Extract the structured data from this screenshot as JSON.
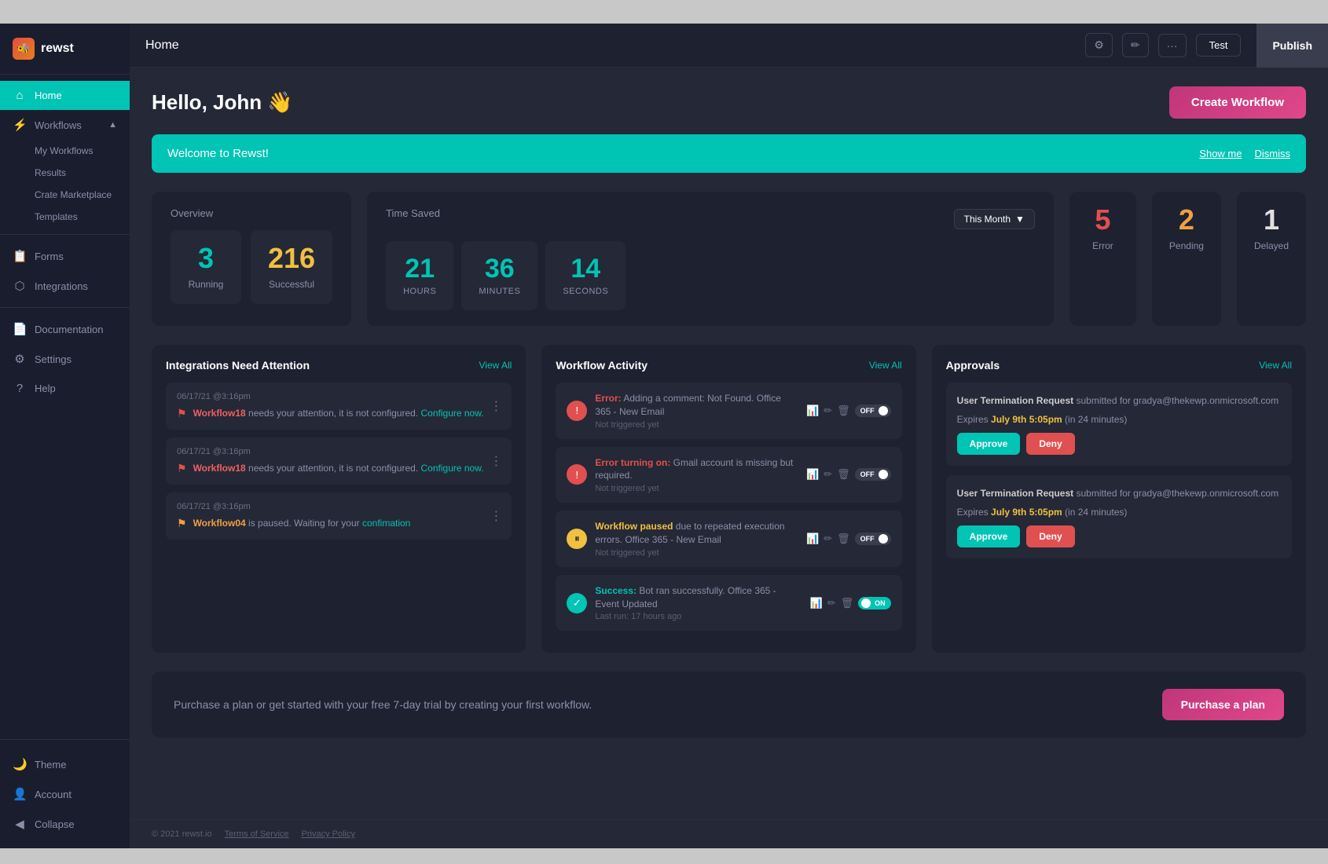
{
  "app": {
    "logo": "🐝",
    "logo_text": "rewst",
    "topbar_title": "Home",
    "publish_label": "Publish",
    "test_label": "Test"
  },
  "sidebar": {
    "nav_items": [
      {
        "id": "home",
        "label": "Home",
        "icon": "⌂",
        "active": true
      },
      {
        "id": "workflows",
        "label": "Workflows",
        "icon": "⚡",
        "has_chevron": true
      },
      {
        "id": "forms",
        "label": "Forms",
        "icon": "📋"
      },
      {
        "id": "integrations",
        "label": "Integrations",
        "icon": "🔗"
      },
      {
        "id": "documentation",
        "label": "Documentation",
        "icon": "📄"
      },
      {
        "id": "settings",
        "label": "Settings",
        "icon": "⚙"
      },
      {
        "id": "help",
        "label": "Help",
        "icon": "?"
      }
    ],
    "sub_items": [
      "My Workflows",
      "Results",
      "Crate Marketplace",
      "Templates"
    ],
    "bottom_items": [
      {
        "id": "theme",
        "label": "Theme",
        "icon": "🌙"
      },
      {
        "id": "account",
        "label": "Account",
        "icon": "👤"
      },
      {
        "id": "collapse",
        "label": "Collapse",
        "icon": "◀"
      }
    ]
  },
  "page": {
    "greeting": "Hello, John 👋",
    "create_btn": "Create Workflow"
  },
  "welcome_banner": {
    "text": "Welcome to Rewst!",
    "show_me": "Show me",
    "dismiss": "Dismiss"
  },
  "overview": {
    "label": "Overview",
    "running": {
      "num": "3",
      "label": "Running"
    },
    "successful": {
      "num": "216",
      "label": "Successful"
    }
  },
  "time_saved": {
    "label": "Time Saved",
    "dropdown": "This Month",
    "hours": "21",
    "minutes": "36",
    "seconds": "14"
  },
  "extra_stats": [
    {
      "num": "5",
      "label": "Error",
      "color": "red"
    },
    {
      "num": "2",
      "label": "Pending",
      "color": "orange"
    },
    {
      "num": "1",
      "label": "Delayed",
      "color": "white"
    }
  ],
  "integrations": {
    "title": "Integrations Need Attention",
    "view_all": "View All",
    "items": [
      {
        "date": "06/17/21 @3:16pm",
        "wf_name": "Workflow18",
        "text": " needs your attention, it is not configured.",
        "link_text": "Configure now.",
        "flag_color": "red"
      },
      {
        "date": "06/17/21 @3:16pm",
        "wf_name": "Workflow18",
        "text": " needs your attention, it is not configured.",
        "link_text": "Configure now.",
        "flag_color": "red"
      },
      {
        "date": "06/17/21 @3:16pm",
        "wf_name": "Workflow04",
        "text": " is paused. Waiting for your ",
        "link_text": "confimation",
        "flag_color": "orange"
      }
    ]
  },
  "workflow_activity": {
    "title": "Workflow Activity",
    "view_all": "View All",
    "items": [
      {
        "type": "error",
        "icon": "!",
        "label": "Error:",
        "desc": " Adding a comment: Not Found. Office 365 - New Email",
        "sub": "Not triggered yet",
        "toggle": "off"
      },
      {
        "type": "error",
        "icon": "!",
        "label": "Error turning on:",
        "desc": " Gmail account is missing but required.",
        "sub": "Not triggered yet",
        "toggle": "off"
      },
      {
        "type": "warning",
        "icon": "⏸",
        "label": "Workflow paused",
        "desc": " due to repeated execution errors. Office 365 - New Email",
        "sub": "Not triggered yet",
        "toggle": "off"
      },
      {
        "type": "success",
        "icon": "✓",
        "label": "Success:",
        "desc": " Bot ran successfully. Office 365 - Event Updated",
        "sub": "Last run: 17 hours ago",
        "toggle": "on"
      }
    ]
  },
  "approvals": {
    "title": "Approvals",
    "view_all": "View All",
    "items": [
      {
        "title": "User Termination Request",
        "text": " submitted for gradya@thekewp.onmicrosoft.com",
        "expires_text": "Expires ",
        "expires_date": "July 9th 5:05pm",
        "expires_suffix": " (in 24 minutes)",
        "approve_label": "Approve",
        "deny_label": "Deny"
      },
      {
        "title": "User Termination Request",
        "text": " submitted for gradya@thekewp.onmicrosoft.com",
        "expires_text": "Expires ",
        "expires_date": "July 9th 5:05pm",
        "expires_suffix": " (in 24 minutes)",
        "approve_label": "Approve",
        "deny_label": "Deny"
      }
    ]
  },
  "purchase": {
    "text": "Purchase a plan or get started with your free 7-day trial by creating your first workflow.",
    "btn_label": "Purchase a plan"
  },
  "footer": {
    "copyright": "© 2021 rewst.io",
    "terms": "Terms of Service",
    "privacy": "Privacy Policy"
  }
}
